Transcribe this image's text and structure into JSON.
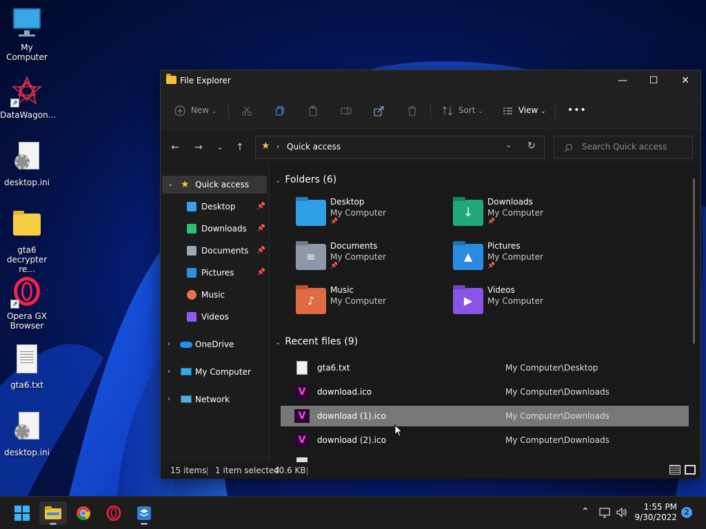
{
  "desktop": {
    "icons": [
      {
        "label": "My Computer"
      },
      {
        "label": "DataWagon..."
      },
      {
        "label": "desktop.ini"
      },
      {
        "label_line1": "gta6",
        "label_line2": "decrypter re..."
      },
      {
        "label_line1": "Opera GX",
        "label_line2": "Browser"
      },
      {
        "label": "gta6.txt"
      },
      {
        "label": "desktop.ini"
      }
    ]
  },
  "window": {
    "title": "File Explorer",
    "controls": {
      "minimize": "—",
      "maximize": "☐",
      "close": "✕"
    }
  },
  "toolbar": {
    "new_label": "New",
    "sort_label": "Sort",
    "view_label": "View",
    "more_label": "•••"
  },
  "address": {
    "location": "Quick access",
    "search_placeholder": "Search Quick access"
  },
  "sidebar": {
    "quick_access": "Quick access",
    "items": [
      {
        "label": "Desktop",
        "color": "#3aa0e8"
      },
      {
        "label": "Downloads",
        "color": "#2fbf71"
      },
      {
        "label": "Documents",
        "color": "#9aa7b5"
      },
      {
        "label": "Pictures",
        "color": "#2f8fe0"
      },
      {
        "label": "Music",
        "color": "#e8734a"
      },
      {
        "label": "Videos",
        "color": "#8b5cf6"
      }
    ],
    "onedrive": "OneDrive",
    "my_computer": "My Computer",
    "network": "Network"
  },
  "folders": {
    "header": "Folders (6)",
    "items": [
      {
        "name": "Desktop",
        "location": "My Computer",
        "color": "#2f9fe6"
      },
      {
        "name": "Downloads",
        "location": "My Computer",
        "color": "#1fa87a"
      },
      {
        "name": "Documents",
        "location": "My Computer",
        "color": "#8d99a8"
      },
      {
        "name": "Pictures",
        "location": "My Computer",
        "color": "#2b8be0"
      },
      {
        "name": "Music",
        "location": "My Computer",
        "color": "#e06a44"
      },
      {
        "name": "Videos",
        "location": "My Computer",
        "color": "#8a55e6"
      }
    ]
  },
  "recent": {
    "header": "Recent files (9)",
    "rows": [
      {
        "name": "gta6.txt",
        "location": "My Computer\\Desktop"
      },
      {
        "name": "download.ico",
        "location": "My Computer\\Downloads"
      },
      {
        "name": "download (1).ico",
        "location": "My Computer\\Downloads"
      },
      {
        "name": "download (2).ico",
        "location": "My Computer\\Downloads"
      }
    ]
  },
  "status": {
    "items": "15 items",
    "selected": "1 item selected",
    "size": "40.6 KB"
  },
  "tray": {
    "time": "1:55 PM",
    "date": "9/30/2022",
    "notifications": "2"
  }
}
